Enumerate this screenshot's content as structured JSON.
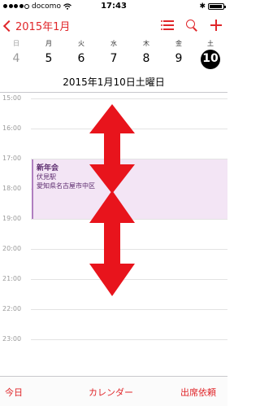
{
  "status": {
    "carrier": "docomo",
    "time": "17:43",
    "signal_filled": 4,
    "signal_total": 5,
    "bluetooth": "✱"
  },
  "nav": {
    "back_label": "2015年1月",
    "icons": [
      "list-icon",
      "search-icon",
      "plus-icon"
    ]
  },
  "week": {
    "days": [
      {
        "dow": "日",
        "num": "4",
        "gray": true
      },
      {
        "dow": "月",
        "num": "5",
        "gray": false
      },
      {
        "dow": "火",
        "num": "6",
        "gray": false
      },
      {
        "dow": "水",
        "num": "7",
        "gray": false
      },
      {
        "dow": "木",
        "num": "8",
        "gray": false
      },
      {
        "dow": "金",
        "num": "9",
        "gray": false
      },
      {
        "dow": "土",
        "num": "10",
        "gray": false,
        "selected": true
      }
    ]
  },
  "date_label": "2015年1月10日土曜日",
  "hours": [
    "15:00",
    "16:00",
    "17:00",
    "18:00",
    "19:00",
    "20:00",
    "21:00",
    "22:00",
    "23:00"
  ],
  "event": {
    "title": "新年会",
    "line1": "伏見駅",
    "line2": "愛知県名古屋市中区"
  },
  "toolbar": {
    "today": "今日",
    "calendars": "カレンダー",
    "invites": "出席依頼"
  },
  "colors": {
    "accent": "#e0262a",
    "event_bg": "#f3e5f5",
    "arrow": "#e8141c"
  }
}
